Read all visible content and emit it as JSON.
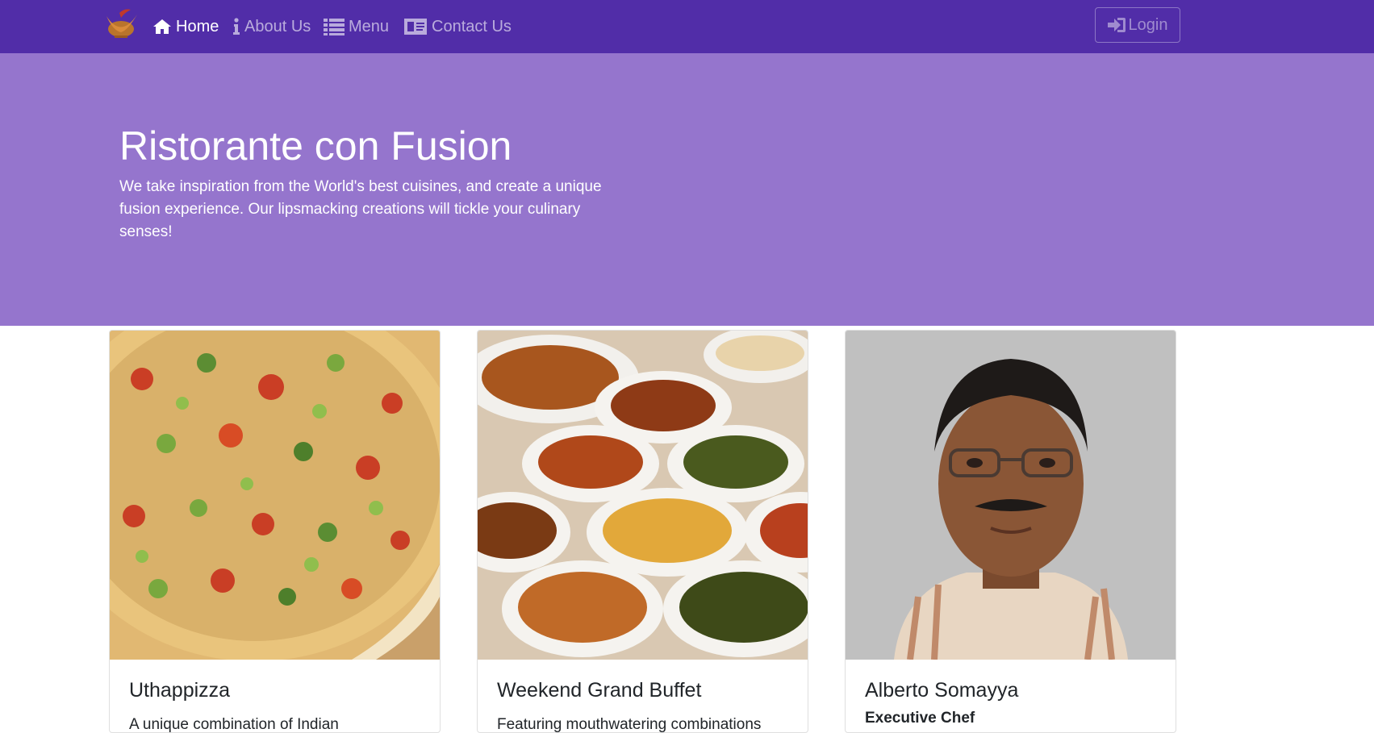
{
  "navbar": {
    "brand_alt": "Ristorante con Fusion logo",
    "items": [
      {
        "label": "Home",
        "icon": "home-icon",
        "active": true
      },
      {
        "label": "About Us",
        "icon": "info-icon",
        "active": false
      },
      {
        "label": "Menu",
        "icon": "list-icon",
        "active": false
      },
      {
        "label": "Contact Us",
        "icon": "address-card-icon",
        "active": false
      }
    ],
    "login_label": "Login"
  },
  "jumbotron": {
    "title": "Ristorante con Fusion",
    "text": "We take inspiration from the World's best cuisines, and create a unique fusion experience. Our lipsmacking creations will tickle your culinary senses!"
  },
  "cards": [
    {
      "title": "Uthappizza",
      "subtitle": "",
      "text": "A unique combination of Indian",
      "image": "pizza-photo"
    },
    {
      "title": "Weekend Grand Buffet",
      "subtitle": "",
      "text": "Featuring mouthwatering combinations",
      "image": "buffet-photo"
    },
    {
      "title": "Alberto Somayya",
      "subtitle": "Executive Chef",
      "text": "",
      "image": "chef-portrait-photo"
    }
  ],
  "colors": {
    "primary": "#512DA8",
    "jumbotron": "#9575CD",
    "card_border": "#dfdfdf"
  }
}
